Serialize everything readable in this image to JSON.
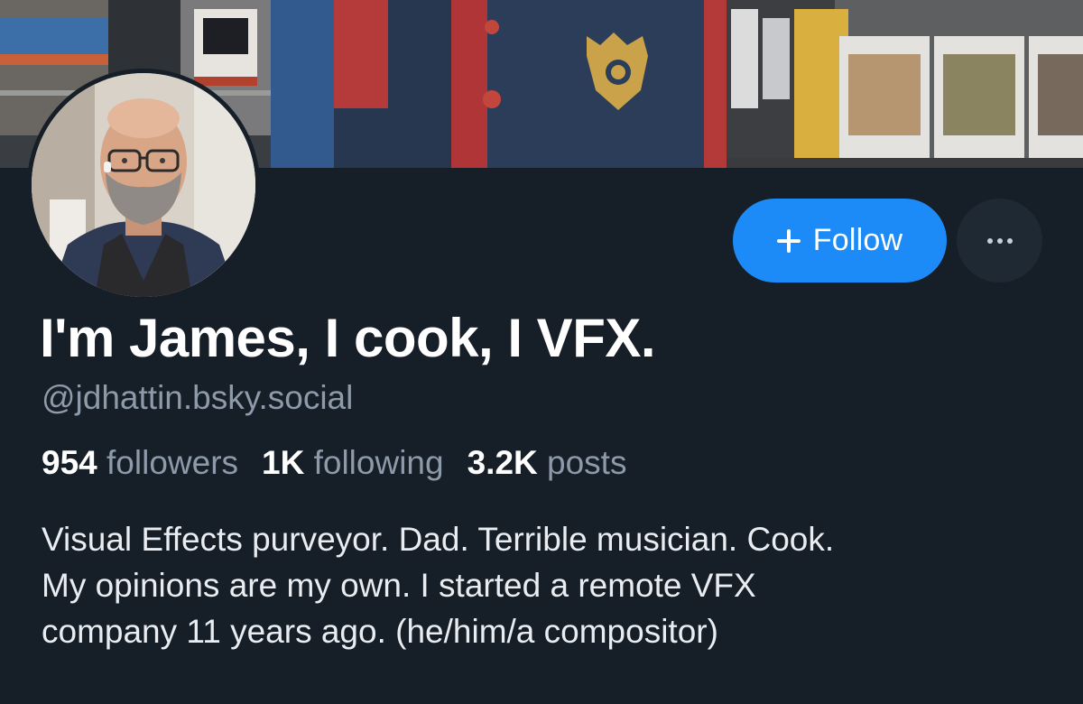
{
  "banner": {
    "description_icon": "banner-image"
  },
  "avatar": {
    "icon": "profile-photo"
  },
  "actions": {
    "follow_label": "Follow",
    "follow_icon": "plus-icon",
    "more_icon": "ellipsis-icon"
  },
  "profile": {
    "display_name": "I'm James, I cook, I VFX.",
    "handle": "@jdhattin.bsky.social"
  },
  "stats": {
    "followers_count": "954",
    "followers_label": "followers",
    "following_count": "1K",
    "following_label": "following",
    "posts_count": "3.2K",
    "posts_label": "posts"
  },
  "bio": {
    "lines": [
      "Visual Effects purveyor. Dad. Terrible musician. Cook.",
      "My opinions are my own. I started a remote VFX",
      "company 11 years ago. (he/him/a compositor)"
    ]
  },
  "colors": {
    "background": "#161e27",
    "accent": "#1c8bf7",
    "muted_text": "#8d9aa9",
    "primary_text": "#ffffff"
  }
}
